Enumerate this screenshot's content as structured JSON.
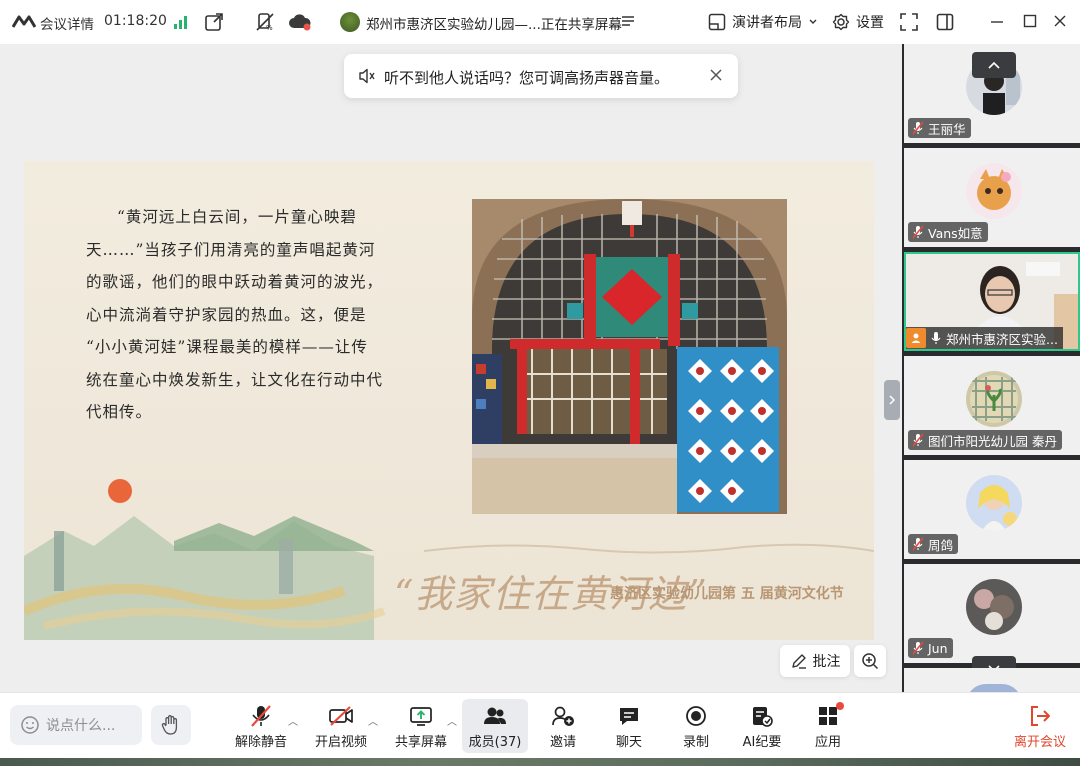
{
  "titlebar": {
    "meeting_details": "会议详情",
    "elapsed_time": "01:18:20",
    "share_status": "郑州市惠济区实验幼儿园—...正在共享屏幕",
    "layout_label": "演讲者布局",
    "settings_label": "设置",
    "icons": [
      "app-logo-icon",
      "signal-icon",
      "external-window-icon",
      "mute-all-icon",
      "cloud-record-icon",
      "list-icon",
      "layout-icon",
      "gear-icon",
      "fullscreen-icon",
      "sidebar-toggle-icon",
      "minimize-icon",
      "maximize-icon",
      "close-icon"
    ]
  },
  "toast": {
    "message": "听不到他人说话吗？您可调高扬声器音量。"
  },
  "slide": {
    "poem_lines": [
      "“黄河远上白云间，一片童心映碧",
      "天……”当孩子们用清亮的童声唱起黄河",
      "的歌谣，他们的眼中跃动着黄河的波光，",
      "心中流淌着守护家园的热血。这，便是",
      "“小小黄河娃”课程最美的模样——让传",
      "统在童心中焕发新生，让文化在行动中代",
      "代相传。"
    ],
    "slogan_big": "“我家住在黄河边”",
    "slogan_small": "惠济区实验幼儿园第 五 届黄河文化节"
  },
  "stage_controls": {
    "annotate_label": "批注"
  },
  "participants": [
    {
      "name": "王丽华",
      "muted": true
    },
    {
      "name": "Vans如意",
      "muted": true
    },
    {
      "name": "郑州市惠济区实验...",
      "muted": false,
      "host": true,
      "active": true
    },
    {
      "name": "图们市阳光幼儿园 秦丹",
      "muted": true
    },
    {
      "name": "周鸽",
      "muted": true
    },
    {
      "name": "Jun",
      "muted": true
    }
  ],
  "toolbar": {
    "chat_placeholder": "说点什么...",
    "unmute": "解除静音",
    "start_video": "开启视频",
    "share_screen": "共享屏幕",
    "members": "成员(37)",
    "invite": "邀请",
    "chat": "聊天",
    "record": "录制",
    "ai_minutes": "AI纪要",
    "apps": "应用",
    "leave": "离开会议"
  },
  "colors": {
    "accent_green": "#2ec88a",
    "leave_red": "#e0472f",
    "host_orange": "#f08a2c"
  }
}
